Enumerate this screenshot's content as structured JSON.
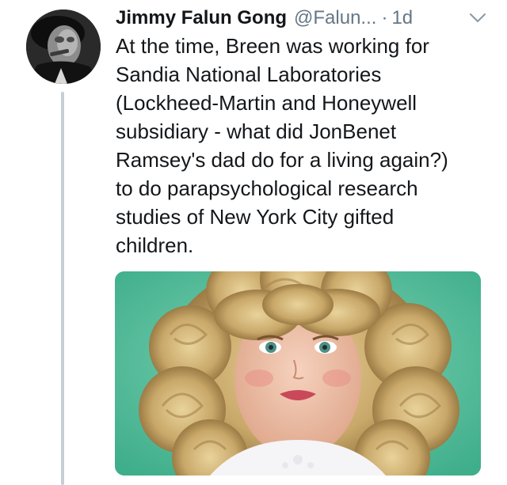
{
  "tweet": {
    "author_name": "Jimmy Falun Gong",
    "author_handle": "@Falun...",
    "separator": "·",
    "timestamp": "1d",
    "text": "At the time, Breen was working for\nSandia National Laboratories\n(Lockheed-Martin and Honeywell\nsubsidiary - what did JonBenet\nRamsey's dad do for a living again?)\nto do parapsychological research\nstudies of New York City gifted\nchildren."
  },
  "icons": {
    "caret": "chevron-down-icon"
  },
  "colors": {
    "text": "#14171a",
    "secondary": "#657786",
    "thread_line": "#c4cfd6",
    "media_background": "#5fc6a4"
  }
}
